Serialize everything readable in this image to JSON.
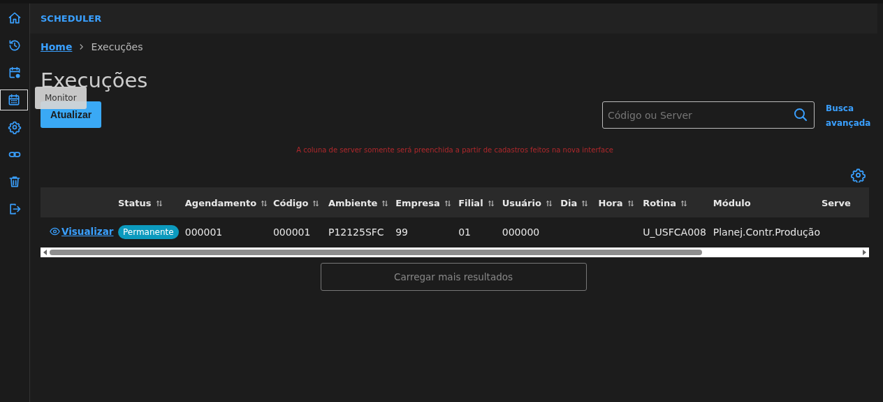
{
  "sidebar": {
    "items": [
      {
        "selected": false
      },
      {
        "selected": false
      },
      {
        "selected": false
      },
      {
        "selected": true,
        "tooltip": "Monitor"
      },
      {
        "selected": false
      },
      {
        "selected": false
      },
      {
        "selected": false
      },
      {
        "selected": false
      }
    ]
  },
  "header": {
    "title": "SCHEDULER"
  },
  "breadcrumb": [
    {
      "label": "Home",
      "link": true
    },
    {
      "label": "Execuções",
      "link": false
    }
  ],
  "page_title": "Execuções",
  "refresh_button": "Atualizar",
  "search": {
    "placeholder": "Código ou Server"
  },
  "advanced_search": "Busca avançada",
  "notice": "A coluna de server somente será preenchida a partir de cadastros feitos na nova interface",
  "table": {
    "columns": [
      {
        "sortable": false
      },
      {
        "label": "Status",
        "sortable": true
      },
      {
        "label": "Agendamento",
        "sortable": true
      },
      {
        "label": "Código",
        "sortable": true
      },
      {
        "label": "Ambiente",
        "sortable": true
      },
      {
        "label": "Empresa",
        "sortable": true
      },
      {
        "label": "Filial",
        "sortable": true
      },
      {
        "label": "Usuário",
        "sortable": true
      },
      {
        "label": "Dia",
        "sortable": true
      },
      {
        "label": "Hora",
        "sortable": true
      },
      {
        "label": "Rotina",
        "sortable": true
      },
      {
        "label": "Módulo",
        "sortable": false
      },
      {
        "label": "Serve",
        "sortable": false
      }
    ],
    "rows": [
      {
        "cells": [
          "Visualizar",
          "Permanente",
          "000001",
          "000001",
          "P12125SFC",
          "99",
          "01",
          "000000",
          "",
          "",
          "U_USFCA008",
          "Planej.Contr.Produção",
          ""
        ]
      }
    ]
  },
  "load_more_button": "Carregar mais resultados"
}
